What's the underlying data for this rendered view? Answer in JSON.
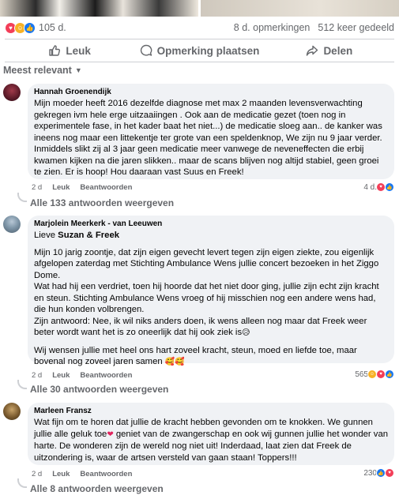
{
  "post": {
    "reaction_count": "105 d.",
    "comments_count": "8 d. opmerkingen",
    "shares_count": "512 keer gedeeld",
    "actions": {
      "like": "Leuk",
      "comment": "Opmerking plaatsen",
      "share": "Delen"
    },
    "sort_label": "Meest relevant"
  },
  "comments": [
    {
      "author": "Hannah Groenendijk",
      "text": "Mijn moeder heeft 2016 dezelfde diagnose met max 2 maanden levensverwachting gekregen ivm hele erge uitzaaiingen . Ook aan de medicatie gezet (toen nog in experimentele fase, in het kader baat het niet...) de medicatie sloeg aan.. de kanker was ineens nog maar een littekentje ter grote van een speldenknop, We zijn nu 9 jaar verder. Inmiddels slikt zij al 3 jaar geen medicatie meer vanwege de neveneffecten die erbij kwamen kijken na die jaren slikken.. maar de scans blijven nog altijd stabiel, geen groei te zien. Er is hoop! Hou daaraan vast Suus en Freek!",
      "time": "2 d",
      "like": "Leuk",
      "reply": "Beantwoorden",
      "reactions": "4 d.",
      "replies": "Alle 133 antwoorden weergeven"
    },
    {
      "author": "Marjolein Meerkerk - van Leeuwen",
      "greeting_prefix": "Lieve ",
      "greeting_names": "Suzan & Freek",
      "paragraph1": "Mijn 10 jarig zoontje, dat zijn eigen gevecht levert tegen zijn eigen ziekte, zou eigenlijk afgelopen zaterdag met Stichting Ambulance Wens jullie concert bezoeken in het Ziggo Dome.",
      "paragraph2": "Wat had hij een verdriet, toen hij hoorde dat het niet door ging, jullie zijn echt zijn kracht en steun. Stichting Ambulance Wens vroeg of hij misschien nog een andere wens had, die hun konden volbrengen.",
      "paragraph3": "Zijn antwoord: Nee, ik wil niks anders doen, ik wens alleen nog maar dat Freek weer beter wordt want het is zo oneerlijk dat hij ook ziek is",
      "paragraph4": "Wij wensen jullie met heel ons hart zoveel kracht, steun, moed en liefde toe, maar bovenal nog zoveel jaren samen",
      "time": "2 d",
      "like": "Leuk",
      "reply": "Beantwoorden",
      "reactions": "565",
      "replies": "Alle 30 antwoorden weergeven"
    },
    {
      "author": "Marleen Fransz",
      "text_part1": "Wat fijn om te horen dat jullie de kracht hebben gevonden om te knokken. We gunnen jullie alle geluk toe",
      "text_part2": " geniet van de zwangerschap en ook wij gunnen jullie het wonder van harte. De wonderen zijn de wereld nog niet uit! Inderdaad, laat zien dat Freek de uitzondering is, waar de artsen versteld van gaan staan! Toppers!!!",
      "time": "2 d",
      "like": "Leuk",
      "reply": "Beantwoorden",
      "reactions": "230",
      "replies": "Alle 8 antwoorden weergeven"
    }
  ],
  "colors": {
    "like_blue": "#1877f2",
    "love_red": "#f33e58",
    "care_yellow": "#f7b125",
    "bubble_bg": "#f0f2f5",
    "secondary_text": "#65676b"
  }
}
